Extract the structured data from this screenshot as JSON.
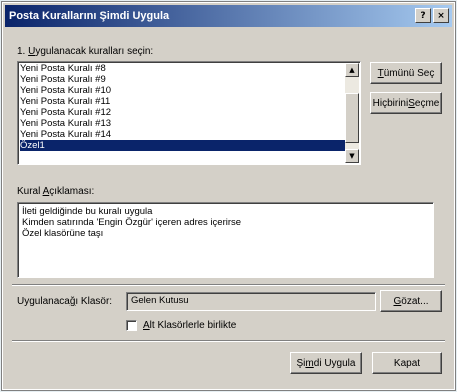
{
  "window": {
    "title": "Posta Kurallarını Şimdi Uygula",
    "help_btn": "?",
    "close_btn": "×"
  },
  "rules_section": {
    "label_prefix": "1. ",
    "label_underlined": "U",
    "label_rest": "ygulanacak kuralları seçin:",
    "items": [
      {
        "label": "Yeni Posta Kuralı #8",
        "selected": false
      },
      {
        "label": "Yeni Posta Kuralı #9",
        "selected": false
      },
      {
        "label": "Yeni Posta Kuralı #10",
        "selected": false
      },
      {
        "label": "Yeni Posta Kuralı #11",
        "selected": false
      },
      {
        "label": "Yeni Posta Kuralı #12",
        "selected": false
      },
      {
        "label": "Yeni Posta Kuralı #13",
        "selected": false
      },
      {
        "label": "Yeni Posta Kuralı #14",
        "selected": false
      },
      {
        "label": "Özel1",
        "selected": true
      }
    ]
  },
  "buttons": {
    "select_all_u": "T",
    "select_all_rest": "ümünü Seç",
    "unselect_all_pre": "Hiçbirini ",
    "unselect_all_u": "S",
    "unselect_all_rest": "eçme",
    "browse_u": "G",
    "browse_rest": "özat...",
    "apply_pre": "Şi",
    "apply_u": "m",
    "apply_rest": "di Uygula",
    "close": "Kapat"
  },
  "description": {
    "label_pre": "Kural ",
    "label_u": "A",
    "label_rest": "çıklaması:",
    "lines": [
      "İleti geldiğinde bu kuralı uygula",
      "Kimden satırında 'Engin Özgür' içeren adres içerirse",
      "Özel klasörüne taşı"
    ]
  },
  "apply_in": {
    "label_pre": "Uygulanaca",
    "label_u": "ğ",
    "label_rest": "ı Klasör:",
    "value": "Gelen Kutusu"
  },
  "subfolders": {
    "checked": false,
    "label_pre": "",
    "label_u": "A",
    "label_rest": "lt Klasörlerle birlikte"
  }
}
